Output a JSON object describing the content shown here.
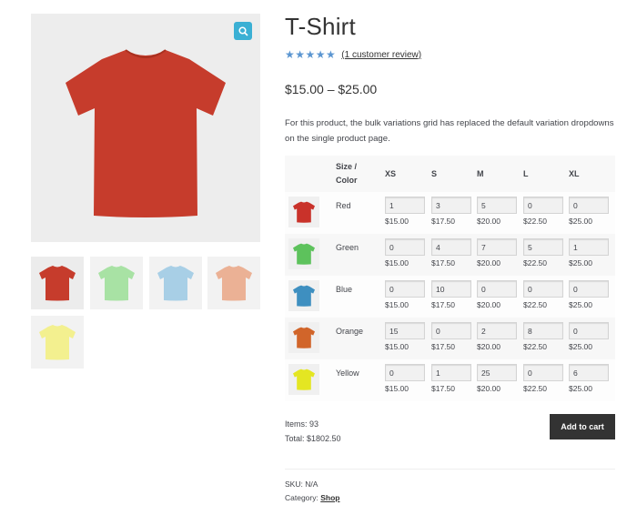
{
  "product": {
    "title": "T-Shirt",
    "stars": "★★★★★",
    "review_link": "(1 customer review)",
    "price_range": "$15.00 – $25.00",
    "description": "For this product, the bulk variations grid has replaced the default variation dropdowns on the single product page."
  },
  "gallery": {
    "main_color": "#c63c2c",
    "thumbs": [
      {
        "name": "red",
        "color": "#c63c2c"
      },
      {
        "name": "green",
        "color": "#a8e2a4"
      },
      {
        "name": "blue",
        "color": "#a8cfe6"
      },
      {
        "name": "orange",
        "color": "#ebb195"
      },
      {
        "name": "yellow",
        "color": "#f3f08f"
      }
    ]
  },
  "grid": {
    "header_size_color": "Size / Color",
    "sizes": [
      "XS",
      "S",
      "M",
      "L",
      "XL"
    ],
    "rows": [
      {
        "color": "Red",
        "swatch": "#c9322a",
        "qty": [
          "1",
          "3",
          "5",
          "0",
          "0"
        ],
        "prices": [
          "$15.00",
          "$17.50",
          "$20.00",
          "$22.50",
          "$25.00"
        ]
      },
      {
        "color": "Green",
        "swatch": "#5dc25c",
        "qty": [
          "0",
          "4",
          "7",
          "5",
          "1"
        ],
        "prices": [
          "$15.00",
          "$17.50",
          "$20.00",
          "$22.50",
          "$25.00"
        ]
      },
      {
        "color": "Blue",
        "swatch": "#3e8fc0",
        "qty": [
          "0",
          "10",
          "0",
          "0",
          "0"
        ],
        "prices": [
          "$15.00",
          "$17.50",
          "$20.00",
          "$22.50",
          "$25.00"
        ]
      },
      {
        "color": "Orange",
        "swatch": "#d1652a",
        "qty": [
          "15",
          "0",
          "2",
          "8",
          "0"
        ],
        "prices": [
          "$15.00",
          "$17.50",
          "$20.00",
          "$22.50",
          "$25.00"
        ]
      },
      {
        "color": "Yellow",
        "swatch": "#e4e622",
        "qty": [
          "0",
          "1",
          "25",
          "0",
          "6"
        ],
        "prices": [
          "$15.00",
          "$17.50",
          "$20.00",
          "$22.50",
          "$25.00"
        ]
      }
    ]
  },
  "summary": {
    "items": "Items: 93",
    "total": "Total: $1802.50",
    "add_to_cart": "Add to cart"
  },
  "meta": {
    "sku": "SKU: N/A",
    "category_label": "Category:",
    "category_link": "Shop"
  }
}
